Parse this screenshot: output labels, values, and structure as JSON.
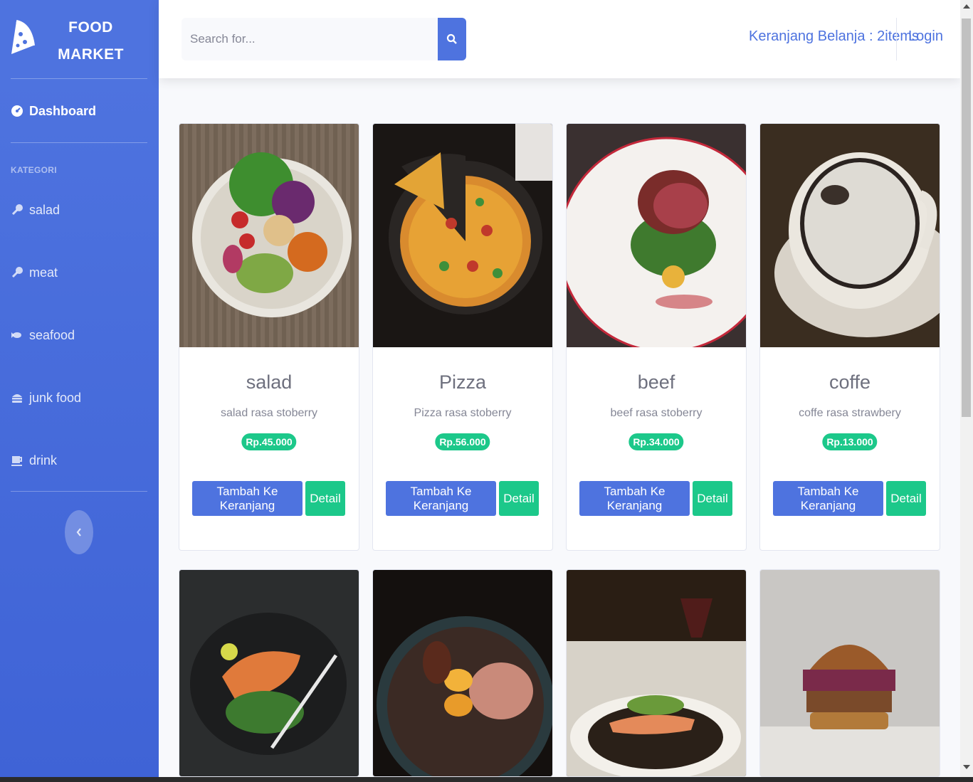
{
  "sidebar": {
    "brand_line1": "FOOD",
    "brand_line2": "MARKET",
    "brand_icon": "pizza-slice-icon",
    "dashboard_label": "Dashboard",
    "heading": "KATEGORI",
    "categories": [
      {
        "label": "salad",
        "icon": "drumstick-icon"
      },
      {
        "label": "meat",
        "icon": "drumstick-icon"
      },
      {
        "label": "seafood",
        "icon": "fish-icon"
      },
      {
        "label": "junk food",
        "icon": "hamburger-icon"
      },
      {
        "label": "drink",
        "icon": "mug-icon"
      }
    ],
    "toggle_icon": "chevron-left-icon"
  },
  "topbar": {
    "search_placeholder": "Search for...",
    "search_icon": "search-icon",
    "cart_label": "Keranjang Belanja : 2items",
    "login_label": "Login"
  },
  "products": [
    {
      "name": "salad",
      "desc": "salad rasa stoberry",
      "price": "Rp.45.000",
      "add_label": "Tambah Ke Keranjang",
      "detail_label": "Detail"
    },
    {
      "name": "Pizza",
      "desc": "Pizza rasa stoberry",
      "price": "Rp.56.000",
      "add_label": "Tambah Ke Keranjang",
      "detail_label": "Detail"
    },
    {
      "name": "beef",
      "desc": "beef rasa stoberry",
      "price": "Rp.34.000",
      "add_label": "Tambah Ke Keranjang",
      "detail_label": "Detail"
    },
    {
      "name": "coffe",
      "desc": "coffe rasa strawbery",
      "price": "Rp.13.000",
      "add_label": "Tambah Ke Keranjang",
      "detail_label": "Detail"
    }
  ],
  "colors": {
    "primary": "#4e73df",
    "success": "#1cc88a"
  }
}
